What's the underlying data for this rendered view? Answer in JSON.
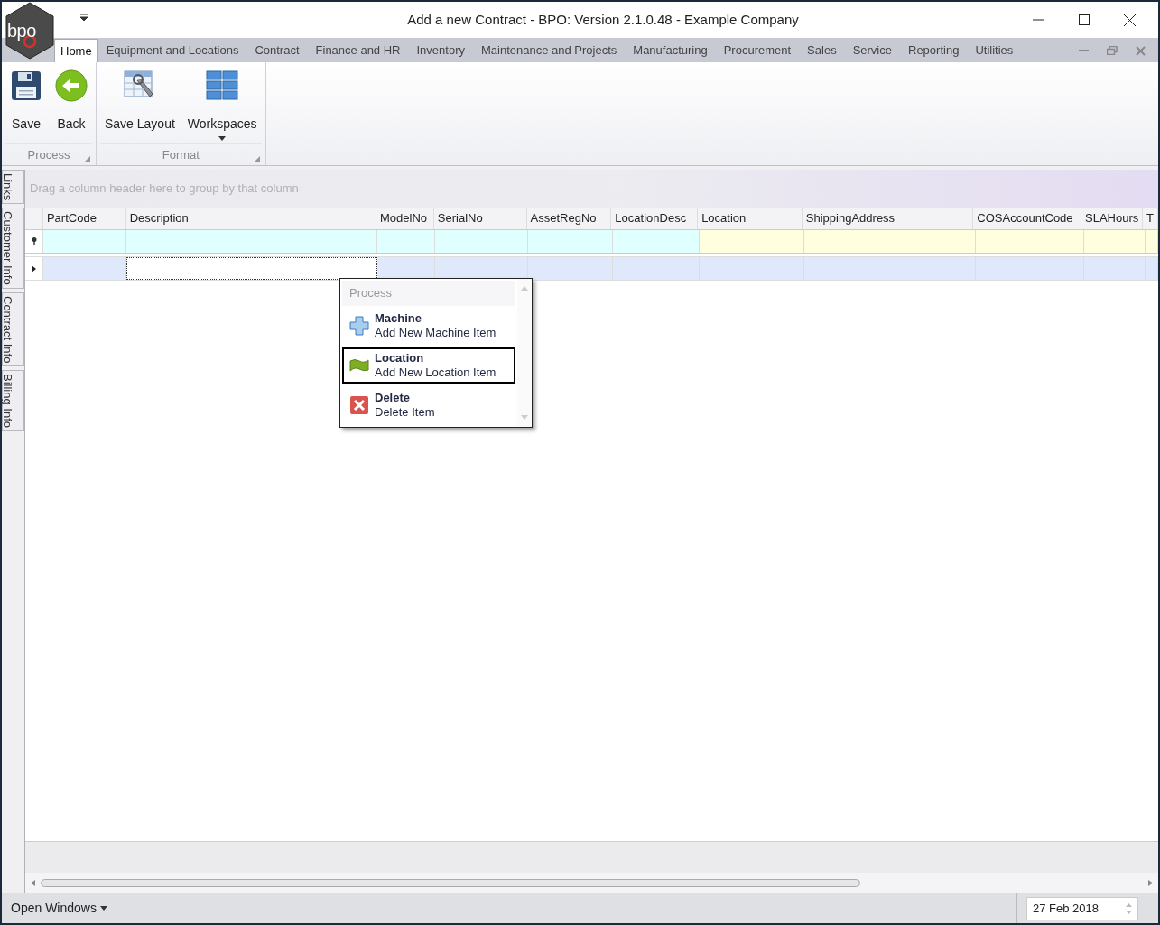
{
  "window": {
    "title": "Add a new Contract - BPO: Version 2.1.0.48 - Example Company",
    "logo": "bpo"
  },
  "ribbon_tabs": [
    {
      "label": "Home",
      "selected": true
    },
    {
      "label": "Equipment and Locations",
      "selected": false
    },
    {
      "label": "Contract",
      "selected": false
    },
    {
      "label": "Finance and HR",
      "selected": false
    },
    {
      "label": "Inventory",
      "selected": false
    },
    {
      "label": "Maintenance and Projects",
      "selected": false
    },
    {
      "label": "Manufacturing",
      "selected": false
    },
    {
      "label": "Procurement",
      "selected": false
    },
    {
      "label": "Sales",
      "selected": false
    },
    {
      "label": "Service",
      "selected": false
    },
    {
      "label": "Reporting",
      "selected": false
    },
    {
      "label": "Utilities",
      "selected": false
    }
  ],
  "ribbon_groups": [
    {
      "label": "Process",
      "buttons": [
        {
          "label": "Save",
          "kind": "save"
        },
        {
          "label": "Back",
          "kind": "back"
        }
      ]
    },
    {
      "label": "Format",
      "buttons": [
        {
          "label": "Save Layout",
          "kind": "layout"
        },
        {
          "label": "Workspaces",
          "kind": "workspaces"
        }
      ]
    }
  ],
  "side_tabs": [
    "Links",
    "Customer Info",
    "Contract Info",
    "Billing Info"
  ],
  "grid": {
    "group_panel": "Drag a column header here to group by that column",
    "columns": [
      {
        "label": "PartCode",
        "color": "#e0ffff"
      },
      {
        "label": "Description",
        "color": "#e0ffff"
      },
      {
        "label": "ModelNo",
        "color": "#e0ffff"
      },
      {
        "label": "SerialNo",
        "color": "#e0ffff"
      },
      {
        "label": "AssetRegNo",
        "color": "#e0ffff"
      },
      {
        "label": "LocationDesc",
        "color": "#e0ffff"
      },
      {
        "label": "Location",
        "color": "#ffffe0"
      },
      {
        "label": "ShippingAddress",
        "color": "#ffffe0"
      },
      {
        "label": "COSAccountCode",
        "color": "#ffffe0"
      },
      {
        "label": "SLAHours",
        "color": "#ffffe0"
      },
      {
        "label": "T",
        "color": "#ffffe0"
      }
    ]
  },
  "context_menu": {
    "header": "Process",
    "items": [
      {
        "title": "Machine",
        "subtitle": "Add New Machine Item",
        "kind": "add",
        "selected": false
      },
      {
        "title": "Location",
        "subtitle": "Add New Location Item",
        "kind": "flag",
        "selected": true
      },
      {
        "title": "Delete",
        "subtitle": "Delete Item",
        "kind": "delete",
        "selected": false
      }
    ]
  },
  "status_bar": {
    "open_windows": "Open Windows",
    "date": "27 Feb 2018"
  }
}
